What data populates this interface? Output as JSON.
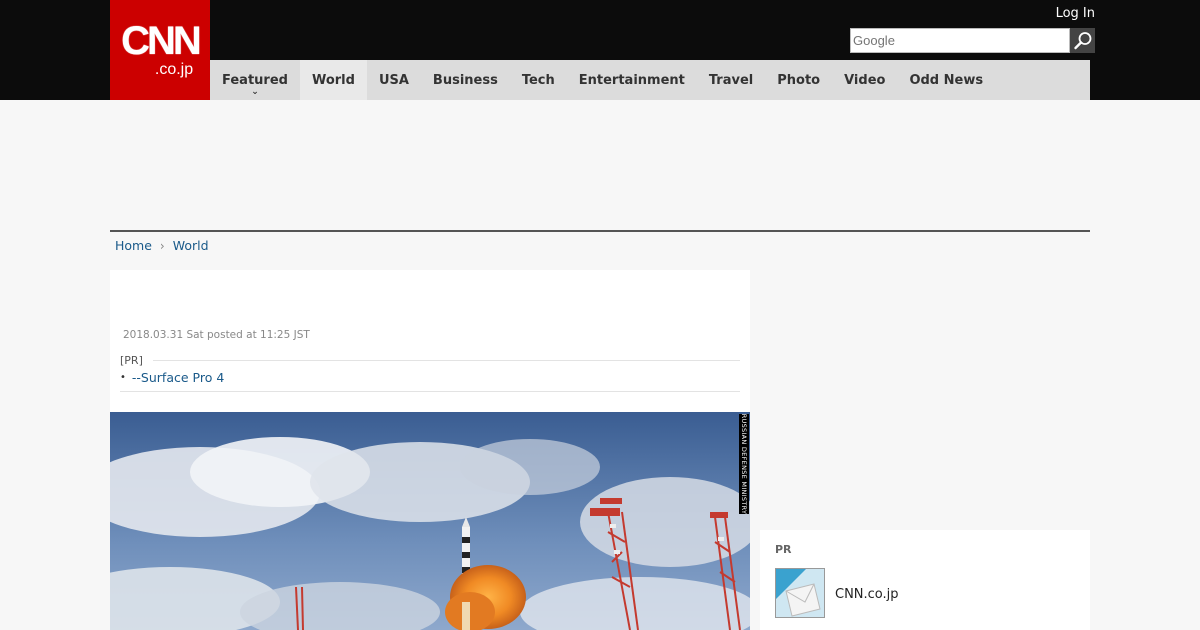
{
  "header": {
    "logo_main": "CNN",
    "logo_sub": ".co.jp",
    "login_label": "Log In",
    "search_placeholder": "Google",
    "brand_color": "#cc0000"
  },
  "nav": {
    "items": [
      {
        "label": "Featured"
      },
      {
        "label": "World"
      },
      {
        "label": "USA"
      },
      {
        "label": "Business"
      },
      {
        "label": "Tech"
      },
      {
        "label": "Entertainment"
      },
      {
        "label": "Travel"
      },
      {
        "label": "Photo"
      },
      {
        "label": "Video"
      },
      {
        "label": "Odd News"
      }
    ],
    "active": "World"
  },
  "breadcrumb": {
    "items": [
      "Home",
      "World"
    ]
  },
  "article": {
    "date": "2018.03.31 Sat posted at 11:25 JST",
    "pr_label": "[PR]",
    "pr_link": "--Surface Pro 4",
    "photo_credit": "RUSSIAN DEFENSE MINISTRY"
  },
  "sidebar": {
    "title": "PR",
    "item_label": "CNN.co.jp"
  }
}
